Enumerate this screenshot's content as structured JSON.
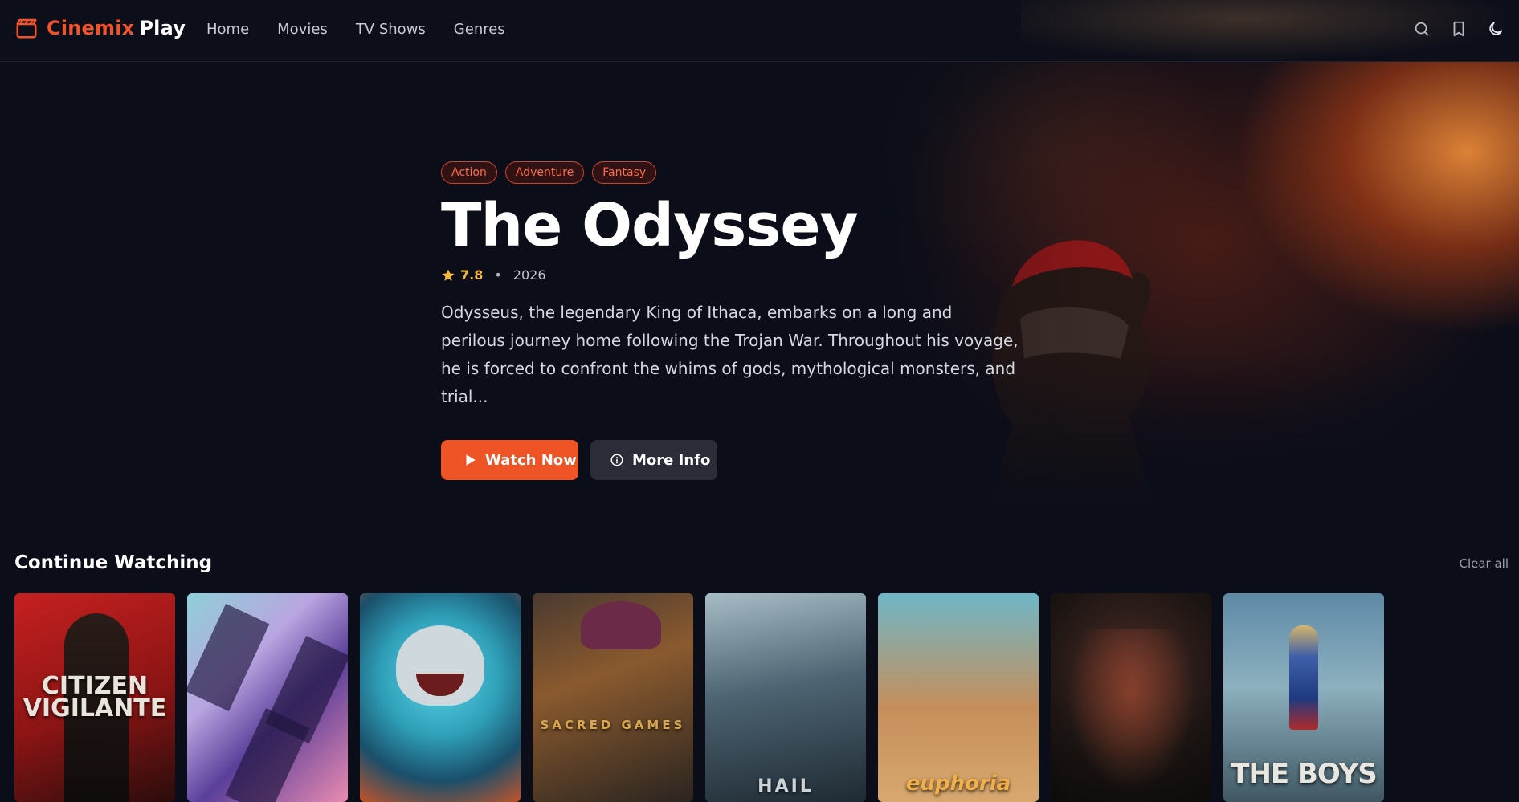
{
  "app": {
    "brand_primary": "Cinemix",
    "brand_secondary": "Play",
    "accent_color": "#ee5425"
  },
  "nav": {
    "items": [
      {
        "label": "Home"
      },
      {
        "label": "Movies"
      },
      {
        "label": "TV Shows"
      },
      {
        "label": "Genres"
      }
    ]
  },
  "header_icons": [
    "search-icon",
    "bookmark-icon",
    "moon-icon"
  ],
  "hero": {
    "genres": [
      "Action",
      "Adventure",
      "Fantasy"
    ],
    "title": "The Odyssey",
    "rating": "7.8",
    "separator": "•",
    "year": "2026",
    "description": "Odysseus, the legendary King of Ithaca, embarks on a long and perilous journey home following the Trojan War. Throughout his voyage, he is forced to confront the whims of gods, mythological monsters, and trial...",
    "watch_label": "Watch Now",
    "info_label": "More Info"
  },
  "continue_watching": {
    "title": "Continue Watching",
    "clear_label": "Clear all",
    "cards": [
      {
        "poster_text": "CITIZEN VIGILANTE"
      },
      {
        "poster_text": ""
      },
      {
        "poster_text": ""
      },
      {
        "poster_text": "SACRED GAMES"
      },
      {
        "poster_text": "HAIL"
      },
      {
        "poster_text": "euphoria"
      },
      {
        "poster_text": ""
      },
      {
        "poster_text": "THE BOYS"
      }
    ]
  }
}
